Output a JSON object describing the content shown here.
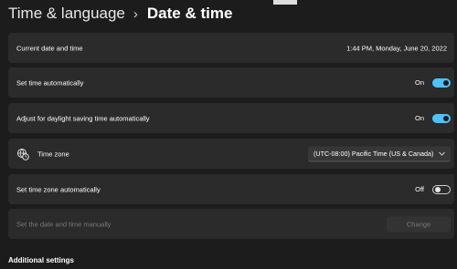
{
  "header": {
    "parent": "Time & language",
    "separator": "›",
    "current": "Date & time"
  },
  "rows": {
    "current_datetime": {
      "label": "Current date and time",
      "value": "1:44 PM, Monday, June 20, 2022"
    },
    "set_time_auto": {
      "label": "Set time automatically",
      "state_text": "On",
      "on": true
    },
    "dst_auto": {
      "label": "Adjust for daylight saving time automatically",
      "state_text": "On",
      "on": true
    },
    "time_zone": {
      "label": "Time zone",
      "icon": "globe-clock-icon",
      "selected": "(UTC-08:00) Pacific Time (US & Canada)"
    },
    "set_tz_auto": {
      "label": "Set time zone automatically",
      "state_text": "Off",
      "on": false
    },
    "set_manual": {
      "label": "Set the date and time manually",
      "button": "Change"
    }
  },
  "additional": {
    "heading": "Additional settings"
  },
  "colors": {
    "accent": "#4cc2ff",
    "card": "#2b2b2b",
    "background": "#1c1c1c"
  }
}
